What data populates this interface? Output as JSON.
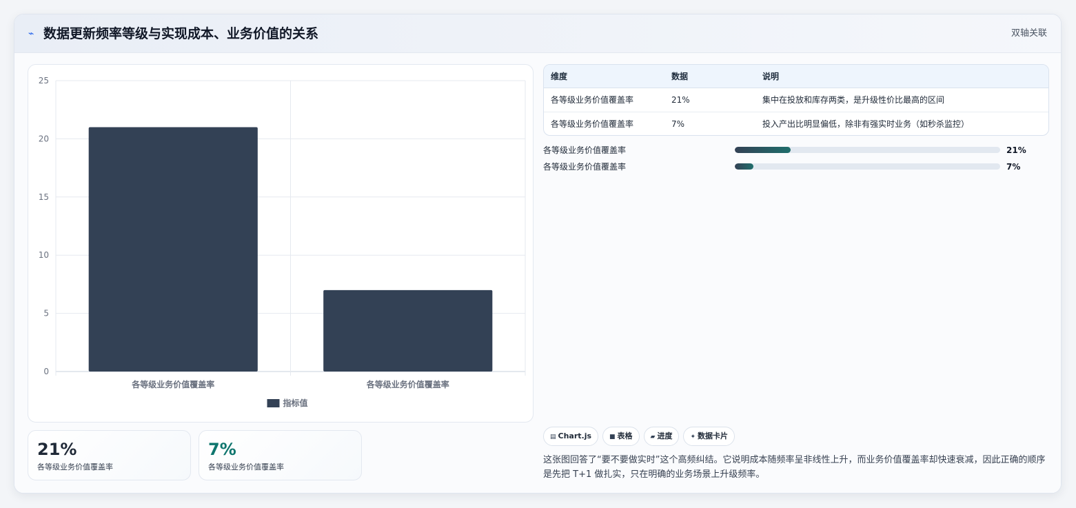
{
  "header": {
    "icon": "chart-bolt-icon",
    "title": "数据更新频率等级与实现成本、业务价值的关系",
    "tag": "双轴关联"
  },
  "chart_data": {
    "type": "bar",
    "categories": [
      "各等级业务价值覆盖率",
      "各等级业务价值覆盖率"
    ],
    "series": [
      {
        "name": "指标值",
        "values": [
          21,
          7
        ]
      }
    ],
    "ylim": [
      0,
      25
    ],
    "yticks": [
      0,
      5,
      10,
      15,
      20,
      25
    ],
    "grid": true,
    "legend": "bottom",
    "bar_color": "#334155"
  },
  "stats": [
    {
      "value": "21%",
      "label": "各等级业务价值覆盖率",
      "color": "#1f2937"
    },
    {
      "value": "7%",
      "label": "各等级业务价值覆盖率",
      "color": "#0f766e"
    }
  ],
  "table": {
    "headers": [
      "维度",
      "数据",
      "说明"
    ],
    "rows": [
      [
        "各等级业务价值覆盖率",
        "21%",
        "集中在投放和库存两类，是升级性价比最高的区间"
      ],
      [
        "各等级业务价值覆盖率",
        "7%",
        "投入产出比明显偏低，除非有强实时业务（如秒杀监控）"
      ]
    ]
  },
  "progress": [
    {
      "label": "各等级业务价值覆盖率",
      "value": "21%",
      "fraction": 0.21
    },
    {
      "label": "各等级业务价值覆盖率",
      "value": "7%",
      "fraction": 0.07
    }
  ],
  "chips": [
    {
      "icon": "chart-icon",
      "glyph": "▤",
      "label": "Chart.js"
    },
    {
      "icon": "table-icon",
      "glyph": "■",
      "label": "表格"
    },
    {
      "icon": "progress-icon",
      "glyph": "▰",
      "label": "进度"
    },
    {
      "icon": "sparkle-icon",
      "glyph": "✦",
      "label": "数据卡片"
    }
  ],
  "summary": "这张图回答了“要不要做实时”这个高频纠结。它说明成本随频率呈非线性上升，而业务价值覆盖率却快速衰减，因此正确的顺序是先把 T+1 做扎实，只在明确的业务场景上升级频率。"
}
